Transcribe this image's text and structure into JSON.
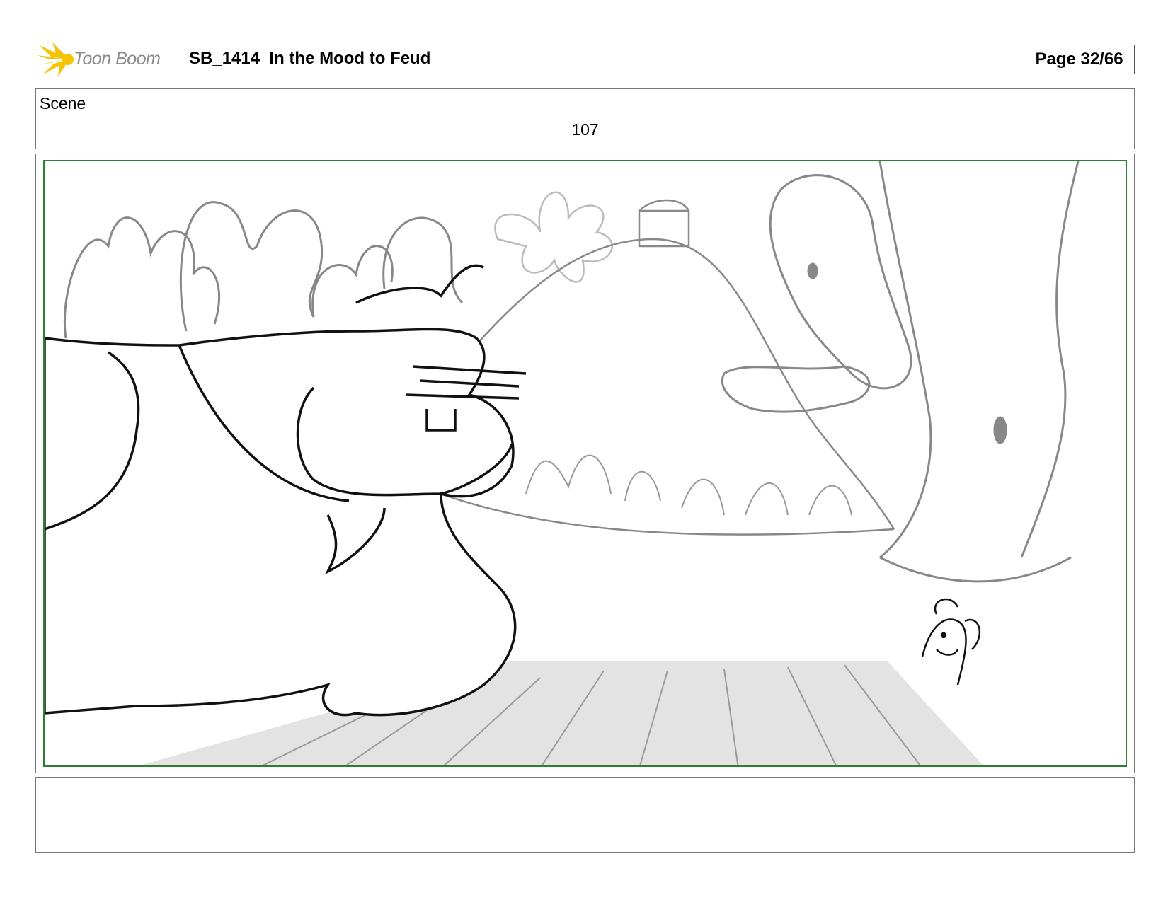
{
  "header": {
    "logo_text": "Toon Boom",
    "title": "SB_1414  In the Mood to Feud",
    "page": "Page 32/66"
  },
  "scene": {
    "label": "Scene",
    "number": "107"
  },
  "notes": {
    "text": ""
  },
  "colors": {
    "logo_burst": "#f5c400",
    "frame_border": "#2e7d32"
  }
}
